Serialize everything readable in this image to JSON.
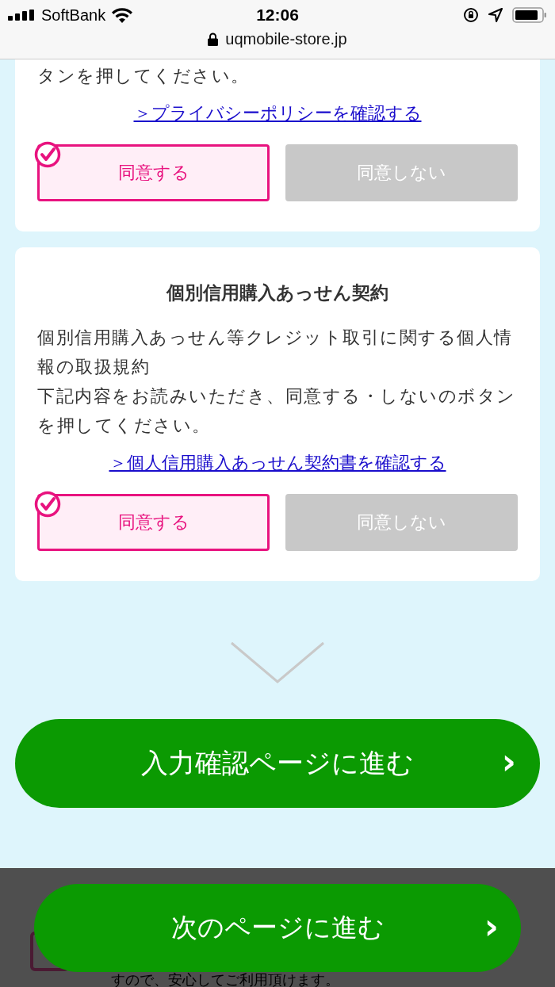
{
  "status_bar": {
    "carrier": "SoftBank",
    "time": "12:06"
  },
  "address_bar": {
    "url": "uqmobile-store.jp"
  },
  "sections": [
    {
      "paragraphs": [
        "タンを押してください。"
      ],
      "link": "＞プライバシーポリシーを確認する",
      "choices": [
        {
          "label": "同意する",
          "selected": true
        },
        {
          "label": "同意しない",
          "selected": false
        }
      ]
    },
    {
      "title": "個別信用購入あっせん契約",
      "paragraphs": [
        "個別信用購入あっせん等クレジット取引に関する個人情報の取扱規約",
        "下記内容をお読みいただき、同意する・しないのボタンを押してください。"
      ],
      "link": "＞個人信用購入あっせん契約書を確認する",
      "choices": [
        {
          "label": "同意する",
          "selected": true
        },
        {
          "label": "同意しない",
          "selected": false
        }
      ]
    }
  ],
  "confirm_button": {
    "label": "入力確認ページに進む",
    "icon": "›"
  },
  "footer": {
    "note": "すので、安心してご利用頂けます。",
    "next_button": {
      "label": "次のページに進む",
      "icon": "›"
    }
  }
}
